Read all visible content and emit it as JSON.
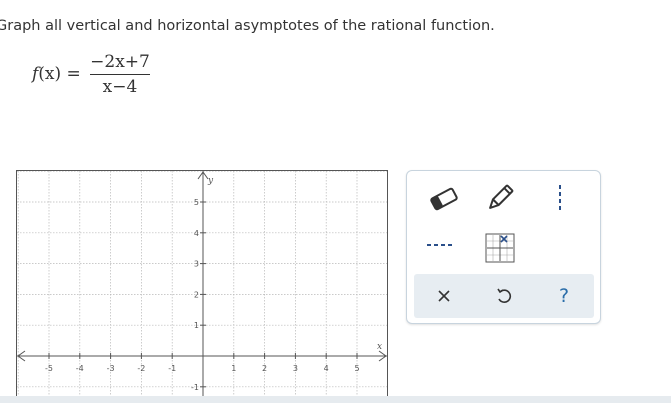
{
  "question": {
    "prompt": "Graph all vertical and horizontal asymptotes of the rational function.",
    "function_name": "f",
    "function_var": "(x) =",
    "numerator": "−2x+7",
    "denominator": "x−4"
  },
  "graph": {
    "x_axis_label": "x",
    "y_axis_label": "y",
    "x_ticks": [
      "-5",
      "-4",
      "-3",
      "-2",
      "-1",
      "1",
      "2",
      "3",
      "4",
      "5"
    ],
    "y_ticks": [
      "5",
      "4",
      "3",
      "2",
      "1",
      "-1"
    ]
  },
  "toolbox": {
    "tools": [
      "eraser-icon",
      "pencil-icon",
      "vertical-dashed-line-icon",
      "horizontal-dashed-line-icon",
      "point-grid-icon"
    ],
    "actions": [
      "close-icon",
      "undo-icon",
      "help-icon"
    ],
    "help_label": "?"
  },
  "colors": {
    "accent": "#2a6da9",
    "action_bar": "#e7edf2",
    "grid": "#b8b8b8",
    "toolbox_border": "#c8d4de"
  }
}
